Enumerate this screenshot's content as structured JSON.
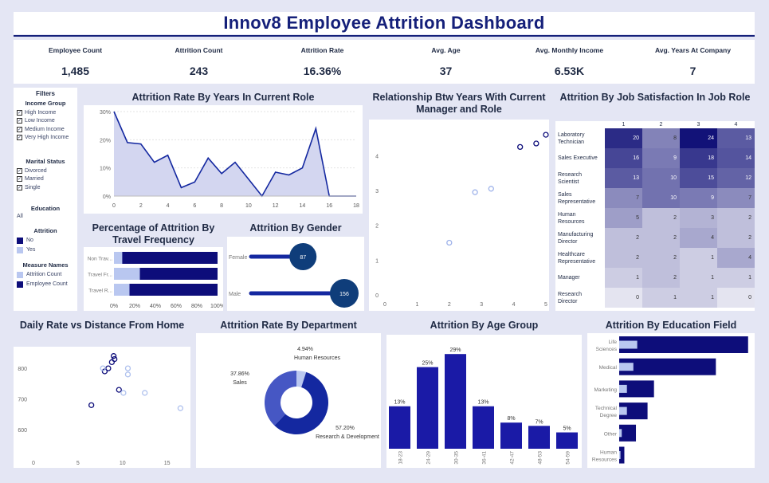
{
  "title": "Innov8 Employee Attrition Dashboard",
  "kpis": [
    {
      "label": "Employee Count",
      "value": "1,485"
    },
    {
      "label": "Attrition Count",
      "value": "243"
    },
    {
      "label": "Attrition Rate",
      "value": "16.36%"
    },
    {
      "label": "Avg. Age",
      "value": "37"
    },
    {
      "label": "Avg. Monthly Income",
      "value": "6.53K"
    },
    {
      "label": "Avg. Years At Company",
      "value": "7"
    }
  ],
  "filters": {
    "title": "Filters",
    "income_group": {
      "title": "Income Group",
      "items": [
        "High Income",
        "Low Income",
        "Medium Income",
        "Very High Income"
      ]
    },
    "marital_status": {
      "title": "Marital Status",
      "items": [
        "Divorced",
        "Married",
        "Single"
      ]
    },
    "education": {
      "title": "Education",
      "value": "All"
    },
    "attrition": {
      "title": "Attrition",
      "items": [
        {
          "label": "No",
          "color": "#0d0d7a"
        },
        {
          "label": "Yes",
          "color": "#b9c7f0"
        }
      ]
    },
    "measure_names": {
      "title": "Measure Names",
      "items": [
        {
          "label": "Attrition Count",
          "color": "#b9c7f0"
        },
        {
          "label": "Employee Count",
          "color": "#0d0d7a"
        }
      ]
    }
  },
  "colors": {
    "dark": "#0d0d7a",
    "mid": "#1428a0",
    "light": "#b9c7f0",
    "area": "#d3d6f0"
  },
  "chart_data": [
    {
      "type": "area",
      "title": "Attrition Rate By Years In Current Role",
      "x": [
        0,
        1,
        2,
        3,
        4,
        5,
        6,
        7,
        8,
        9,
        10,
        11,
        12,
        13,
        14,
        15,
        16,
        17,
        18
      ],
      "values": [
        30,
        19,
        18.5,
        12,
        14.5,
        3,
        5,
        13.5,
        8,
        12,
        6,
        0,
        8.5,
        7.5,
        10,
        24,
        0,
        0,
        0
      ],
      "xticks": [
        "0",
        "2",
        "4",
        "6",
        "8",
        "10",
        "12",
        "14",
        "16",
        "18"
      ],
      "yticks": [
        "0%",
        "10%",
        "20%",
        "30%"
      ],
      "ylim": [
        0,
        30
      ]
    },
    {
      "type": "scatter",
      "title": "Relationship Btw Years With Current Manager and Role",
      "points": [
        {
          "x": 2,
          "y": 1.5,
          "group": "Yes"
        },
        {
          "x": 2.8,
          "y": 2.95,
          "group": "Yes"
        },
        {
          "x": 3.3,
          "y": 3.05,
          "group": "Yes"
        },
        {
          "x": 4.2,
          "y": 4.25,
          "group": "No"
        },
        {
          "x": 4.7,
          "y": 4.35,
          "group": "No"
        },
        {
          "x": 5.0,
          "y": 4.6,
          "group": "No"
        }
      ],
      "xticks": [
        "0",
        "1",
        "2",
        "3",
        "4",
        "5"
      ],
      "yticks": [
        "0",
        "1",
        "2",
        "3",
        "4"
      ],
      "xlim": [
        0,
        5
      ],
      "ylim": [
        0,
        4.9
      ]
    },
    {
      "type": "heatmap",
      "title": "Attrition By Job Satisfaction In Job Role",
      "columns": [
        "1",
        "2",
        "3",
        "4"
      ],
      "rows": [
        {
          "label": "Laboratory Technician",
          "values": [
            20,
            8,
            24,
            13
          ]
        },
        {
          "label": "Sales Executive",
          "values": [
            16,
            9,
            18,
            14
          ]
        },
        {
          "label": "Research Scientist",
          "values": [
            13,
            10,
            15,
            12
          ]
        },
        {
          "label": "Sales Representative",
          "values": [
            7,
            10,
            9,
            7
          ]
        },
        {
          "label": "Human Resources",
          "values": [
            5,
            2,
            3,
            2
          ]
        },
        {
          "label": "Manufacturing Director",
          "values": [
            2,
            2,
            4,
            2
          ]
        },
        {
          "label": "Healthcare Representative",
          "values": [
            2,
            2,
            1,
            4
          ]
        },
        {
          "label": "Manager",
          "values": [
            1,
            2,
            1,
            1
          ]
        },
        {
          "label": "Research Director",
          "values": [
            0,
            1,
            1,
            0
          ]
        }
      ]
    },
    {
      "type": "bar",
      "title": "Percentage of Attrition By Travel Frequency",
      "categories": [
        "Non Trav...",
        "Travel Fr...",
        "Travel R..."
      ],
      "series": [
        {
          "name": "Attrition Count",
          "values": [
            8,
            25,
            15
          ]
        },
        {
          "name": "Employee Count",
          "values": [
            100,
            100,
            100
          ]
        }
      ],
      "xticks": [
        "0%",
        "20%",
        "40%",
        "60%",
        "80%",
        "100%"
      ]
    },
    {
      "type": "bar",
      "title": "Attrition By Gender",
      "categories": [
        "Female",
        "Male"
      ],
      "values": [
        87,
        156
      ]
    },
    {
      "type": "scatter",
      "title": "Daily Rate vs Distance From Home",
      "points": [
        {
          "x": 6.5,
          "y": 680,
          "group": "No"
        },
        {
          "x": 8.0,
          "y": 790,
          "group": "No"
        },
        {
          "x": 8.4,
          "y": 800,
          "group": "No"
        },
        {
          "x": 8.8,
          "y": 820,
          "group": "No"
        },
        {
          "x": 9.0,
          "y": 840,
          "group": "No"
        },
        {
          "x": 9.1,
          "y": 830,
          "group": "No"
        },
        {
          "x": 9.6,
          "y": 730,
          "group": "No"
        },
        {
          "x": 7.8,
          "y": 800,
          "group": "Yes"
        },
        {
          "x": 10.1,
          "y": 720,
          "group": "Yes"
        },
        {
          "x": 10.6,
          "y": 800,
          "group": "Yes"
        },
        {
          "x": 10.6,
          "y": 780,
          "group": "Yes"
        },
        {
          "x": 12.5,
          "y": 720,
          "group": "Yes"
        },
        {
          "x": 16.5,
          "y": 670,
          "group": "Yes"
        }
      ],
      "xticks": [
        "0",
        "5",
        "10",
        "15"
      ],
      "yticks": [
        "600",
        "700",
        "800"
      ],
      "xlim": [
        0,
        17
      ],
      "ylim": [
        520,
        860
      ]
    },
    {
      "type": "pie",
      "title": "Attrition Rate By Department",
      "slices": [
        {
          "label": "Human Resources",
          "pct_label": "4.94%",
          "value": 4.94,
          "color": "#b9c7f0"
        },
        {
          "label": "Research & Development",
          "pct_label": "57.20%",
          "value": 57.2,
          "color": "#1428a0"
        },
        {
          "label": "Sales",
          "pct_label": "37.86%",
          "value": 37.86,
          "color": "#4657c4"
        }
      ]
    },
    {
      "type": "bar",
      "title": "Attrition By Age Group",
      "categories": [
        "18-23",
        "24-29",
        "30-35",
        "36-41",
        "42-47",
        "48-53",
        "54-59"
      ],
      "values": [
        13,
        25,
        29,
        13,
        8,
        7,
        5
      ],
      "labels": [
        "13%",
        "25%",
        "29%",
        "13%",
        "8%",
        "7%",
        "5%"
      ],
      "ylim": [
        0,
        31
      ]
    },
    {
      "type": "bar",
      "title": "Attrition By Education Field",
      "categories": [
        "Life Sciences",
        "Medical",
        "Marketing",
        "Technical Degree",
        "Other",
        "Human Resources"
      ],
      "series": [
        {
          "name": "Employee Count",
          "values": [
            100,
            75,
            27,
            22,
            13,
            4
          ]
        },
        {
          "name": "Attrition Count",
          "values": [
            14,
            11,
            6,
            6,
            2,
            1
          ]
        }
      ],
      "xlim": [
        0,
        102
      ]
    }
  ]
}
